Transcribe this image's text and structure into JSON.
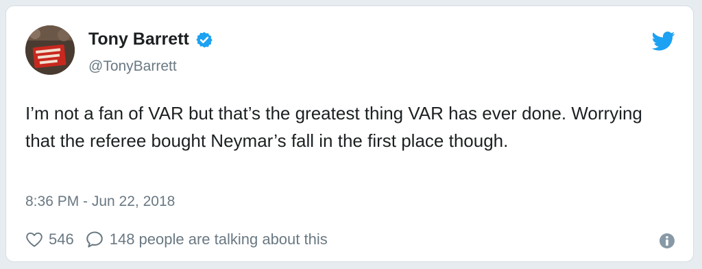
{
  "author": {
    "name": "Tony Barrett",
    "handle": "@TonyBarrett",
    "verified": true,
    "avatar_sign_text": "BEST BOYS IN OTHER SHIRTS"
  },
  "tweet": {
    "text": "I’m not a fan of VAR but that’s the greatest thing VAR has ever done. Worrying that the referee bought Neymar’s fall in the first place though.",
    "timestamp": "8:36 PM - Jun 22, 2018"
  },
  "actions": {
    "likes": "546",
    "conversation": "148 people are talking about this"
  },
  "icons": {
    "brand": "twitter-bird-icon",
    "verified": "verified-badge-icon",
    "like": "heart-icon",
    "reply": "comment-icon",
    "info": "info-icon"
  },
  "colors": {
    "twitter_blue": "#1da1f2",
    "text": "#1c2022",
    "secondary_text": "#697882",
    "border": "#d7dde1"
  }
}
